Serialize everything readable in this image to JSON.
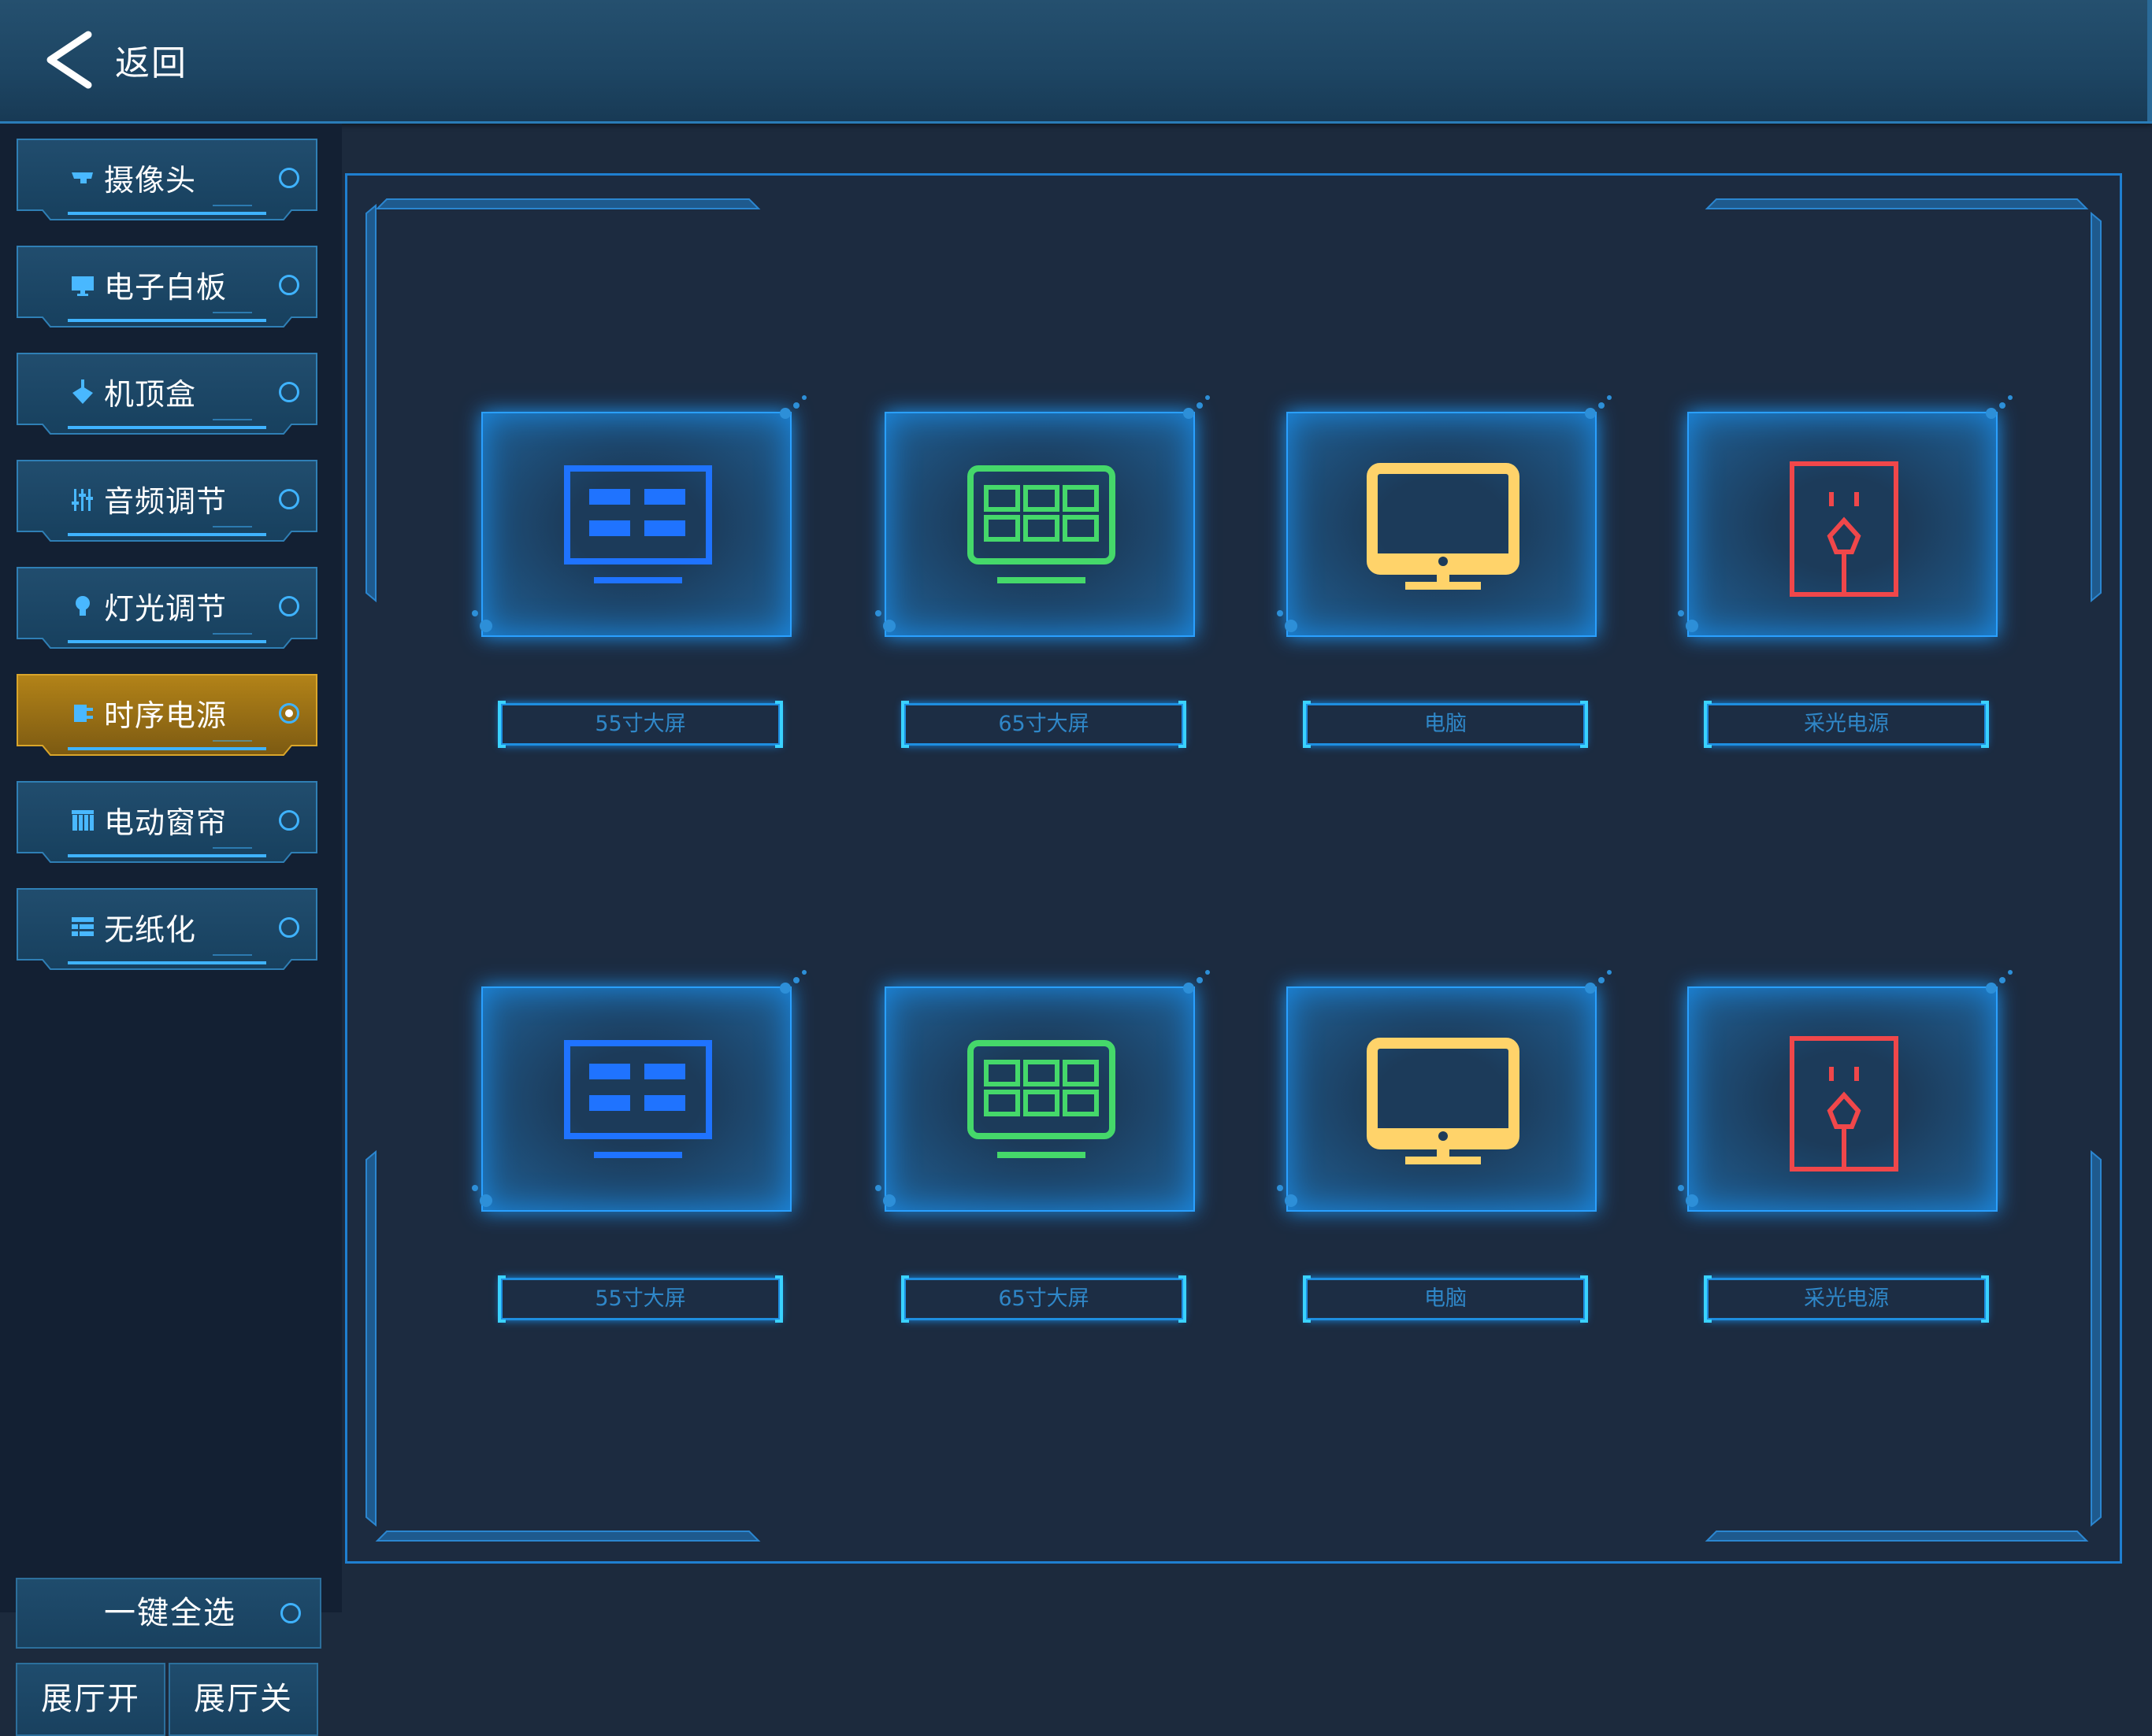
{
  "header": {
    "back_label": "返回"
  },
  "sidebar": {
    "items": [
      {
        "label": "摄像头",
        "icon": "camera-icon",
        "selected": false
      },
      {
        "label": "电子白板",
        "icon": "monitor-icon",
        "selected": false
      },
      {
        "label": "机顶盒",
        "icon": "download-icon",
        "selected": false
      },
      {
        "label": "音频调节",
        "icon": "equalizer-icon",
        "selected": false
      },
      {
        "label": "灯光调节",
        "icon": "bulb-icon",
        "selected": false
      },
      {
        "label": "时序电源",
        "icon": "plug-icon",
        "selected": true
      },
      {
        "label": "电动窗帘",
        "icon": "curtain-icon",
        "selected": false
      },
      {
        "label": "无纸化",
        "icon": "list-icon",
        "selected": false
      }
    ],
    "select_all": "一键全选",
    "hall_on": "展厅开",
    "hall_off": "展厅关"
  },
  "devices": [
    {
      "label": "55寸大屏",
      "icon": "display-55-icon",
      "color": "#1f73ff"
    },
    {
      "label": "65寸大屏",
      "icon": "display-65-icon",
      "color": "#45d86a"
    },
    {
      "label": "电脑",
      "icon": "computer-icon",
      "color": "#ffd36a"
    },
    {
      "label": "采光电源",
      "icon": "power-socket-icon",
      "color": "#f0474a"
    },
    {
      "label": "55寸大屏",
      "icon": "display-55-icon",
      "color": "#1f73ff"
    },
    {
      "label": "65寸大屏",
      "icon": "display-65-icon",
      "color": "#45d86a"
    },
    {
      "label": "电脑",
      "icon": "computer-icon",
      "color": "#ffd36a"
    },
    {
      "label": "采光电源",
      "icon": "power-socket-icon",
      "color": "#f0474a"
    }
  ],
  "colors": {
    "accent": "#1f8fe8",
    "active_item": "#c8941a",
    "background": "#1c2a3d"
  }
}
